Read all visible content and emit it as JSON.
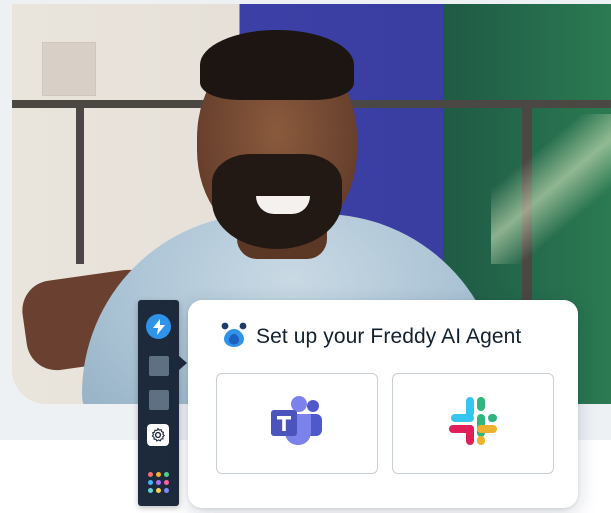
{
  "card": {
    "title": "Set up your Freddy AI Agent",
    "integrations": [
      {
        "name": "Microsoft Teams",
        "icon": "microsoft-teams-icon"
      },
      {
        "name": "Slack",
        "icon": "slack-icon"
      }
    ]
  },
  "sidebar": {
    "items": [
      {
        "icon": "lightning-bolt-icon",
        "color": "#2f93e8"
      },
      {
        "icon": "blank-square-icon"
      },
      {
        "icon": "blank-square-icon"
      },
      {
        "icon": "gear-icon"
      },
      {
        "icon": "apps-grid-icon"
      }
    ]
  },
  "colors": {
    "sidebar_bg": "#1d2a3c",
    "accent": "#2f93e8",
    "teams_purple": "#5059c9",
    "slack_green": "#2eb67d",
    "slack_blue": "#36c5f0",
    "slack_yellow": "#ecb22e",
    "slack_red": "#e01e5a"
  }
}
